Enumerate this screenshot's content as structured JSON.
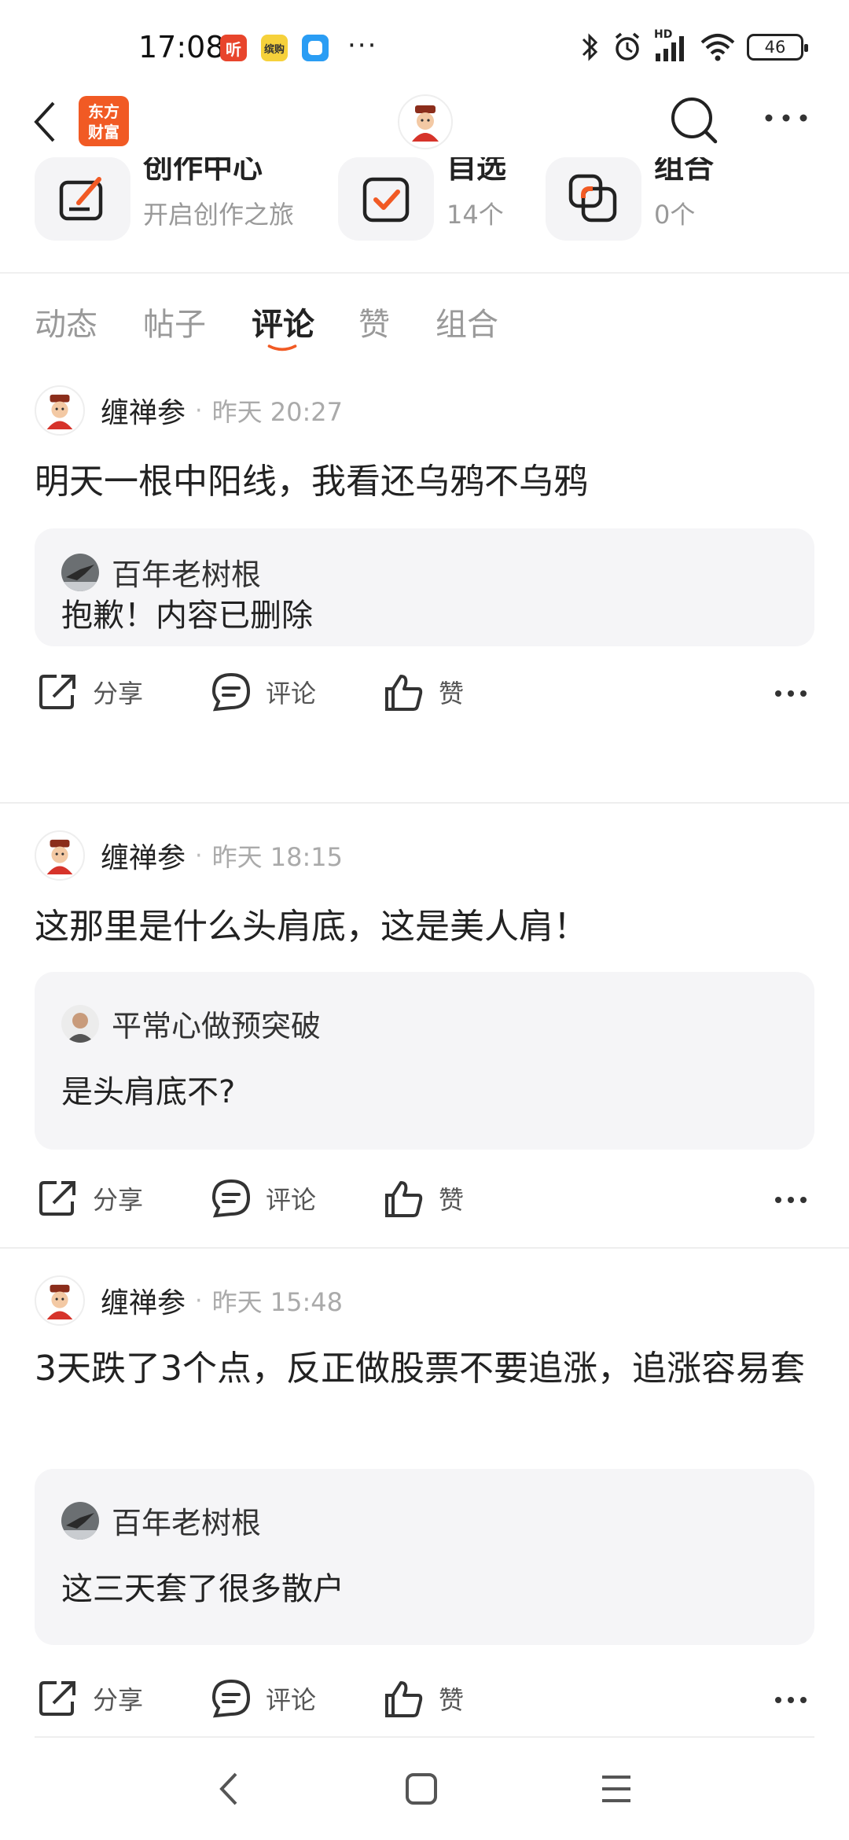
{
  "status": {
    "time": "17:08",
    "notif_labels": [
      "听",
      "缤购",
      ""
    ],
    "battery": "46",
    "network": "HD"
  },
  "nav": {
    "brand_text": "东方财富"
  },
  "quick": [
    {
      "title": "创作中心",
      "sub": "开启创作之旅",
      "icon": "pencil-square-icon"
    },
    {
      "title": "自选",
      "sub": "14个",
      "icon": "check-square-icon"
    },
    {
      "title": "组合",
      "sub": "0个",
      "icon": "overlap-squares-icon"
    }
  ],
  "tabs": [
    "动态",
    "帖子",
    "评论",
    "赞",
    "组合"
  ],
  "active_tab": "评论",
  "accent_color": "#f15a24",
  "posts": [
    {
      "author": "缠禅参",
      "sep": "·",
      "time": "昨天 20:27",
      "text": "明天一根中阳线，我看还乌鸦不乌鸦",
      "quote_name": "百年老树根",
      "quote_text": "抱歉！内容已删除"
    },
    {
      "author": "缠禅参",
      "sep": "·",
      "time": "昨天 18:15",
      "text": "这那里是什么头肩底，这是美人肩！",
      "quote_name": "平常心做预突破",
      "quote_text": "是头肩底不?"
    },
    {
      "author": "缠禅参",
      "sep": "·",
      "time": "昨天 15:48",
      "text": "3天跌了3个点，反正做股票不要追涨，追涨容易套",
      "quote_name": "百年老树根",
      "quote_text": "这三天套了很多散户"
    }
  ],
  "actions": {
    "share": "分享",
    "comment": "评论",
    "like": "赞"
  }
}
